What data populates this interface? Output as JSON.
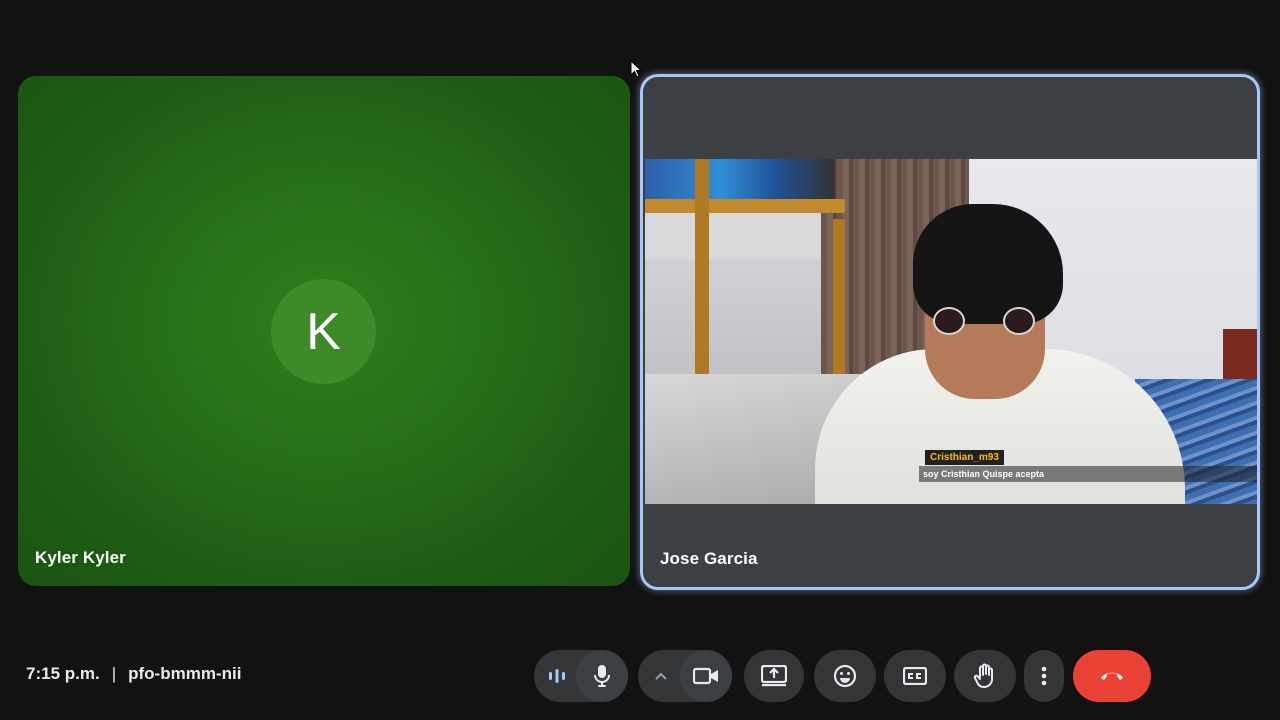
{
  "participants": [
    {
      "name": "Kyler Kyler",
      "avatar_letter": "K",
      "tile_color": "#276f19"
    },
    {
      "name": "Jose Garcia",
      "active_speaker": true,
      "highlight_color": "#a8c7fa"
    }
  ],
  "caption": {
    "speaker": "Cristhian_m93",
    "text": "soy Cristhian Quispe acepta"
  },
  "meeting": {
    "time": "7:15 p.m.",
    "separator": "|",
    "code": "pfo-bmmm-nii"
  },
  "controls": [
    {
      "name": "audio-levels",
      "icon": "audio-levels-icon"
    },
    {
      "name": "microphone",
      "icon": "mic-icon"
    },
    {
      "name": "camera-options",
      "icon": "chevron-up-icon"
    },
    {
      "name": "camera",
      "icon": "videocam-icon"
    },
    {
      "name": "present-screen",
      "icon": "present-icon"
    },
    {
      "name": "reactions",
      "icon": "emoji-icon"
    },
    {
      "name": "captions",
      "icon": "closed-caption-icon"
    },
    {
      "name": "raise-hand",
      "icon": "hand-icon"
    },
    {
      "name": "more-options",
      "icon": "more-vert-icon"
    },
    {
      "name": "leave-call",
      "icon": "call-end-icon",
      "color": "#ea4335"
    }
  ]
}
